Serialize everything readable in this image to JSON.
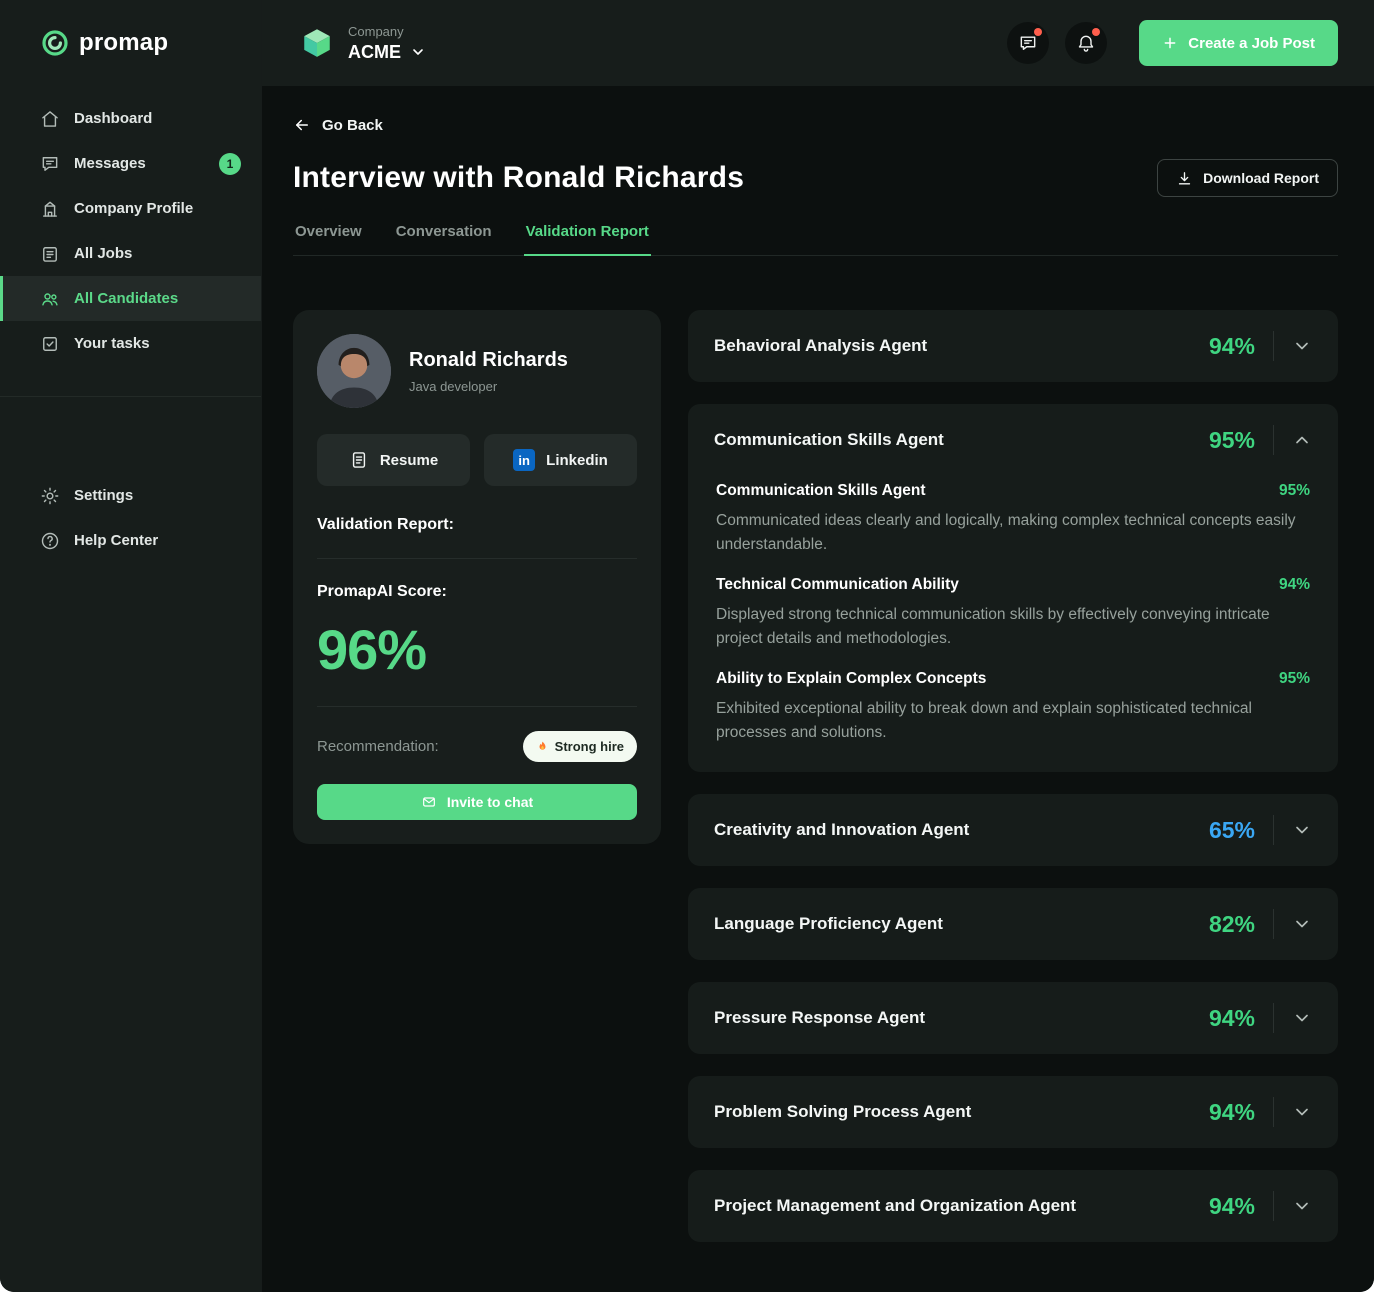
{
  "colors": {
    "accent_green": "#57d988",
    "score_green": "#3fd581",
    "score_blue": "#3aa7f4",
    "alert_red": "#ff5f4d",
    "linkedin_blue": "#0a66c2"
  },
  "sidebar": {
    "logo_text": "promap",
    "items": [
      {
        "label": "Dashboard",
        "icon": "home-icon"
      },
      {
        "label": "Messages",
        "icon": "chat-icon",
        "badge": "1"
      },
      {
        "label": "Company Profile",
        "icon": "building-icon"
      },
      {
        "label": "All Jobs",
        "icon": "clipboard-icon"
      },
      {
        "label": "All Candidates",
        "icon": "people-icon",
        "active": true
      },
      {
        "label": "Your tasks",
        "icon": "task-icon"
      }
    ],
    "footer_items": [
      {
        "label": "Settings",
        "icon": "gear-icon"
      },
      {
        "label": "Help Center",
        "icon": "help-icon"
      }
    ]
  },
  "header": {
    "company_label": "Company",
    "company_name": "ACME",
    "create_job_button": "Create a Job Post"
  },
  "page": {
    "back_label": "Go Back",
    "title": "Interview with Ronald Richards",
    "download_button": "Download Report",
    "tabs": [
      {
        "label": "Overview"
      },
      {
        "label": "Conversation"
      },
      {
        "label": "Validation Report",
        "active": true
      }
    ]
  },
  "candidate": {
    "name": "Ronald Richards",
    "role": "Java developer",
    "resume_button": "Resume",
    "linkedin_button": "Linkedin",
    "linkedin_glyph": "in",
    "validation_report_label": "Validation Report:",
    "score_label": "PromapAI Score:",
    "score": "96%",
    "recommendation_label": "Recommendation:",
    "recommendation_badge": "Strong hire",
    "invite_button": "Invite to chat"
  },
  "agents": [
    {
      "name": "Behavioral Analysis Agent",
      "score": "94%"
    },
    {
      "name": "Communication Skills Agent",
      "score": "95%",
      "expanded": true,
      "sections": [
        {
          "title": "Communication Skills Agent",
          "score": "95%",
          "text": "Communicated ideas clearly and logically, making complex technical concepts easily understandable."
        },
        {
          "title": "Technical Communication Ability",
          "score": "94%",
          "text": "Displayed strong technical communication skills by effectively conveying intricate project details and methodologies."
        },
        {
          "title": "Ability to Explain Complex Concepts",
          "score": "95%",
          "text": "Exhibited exceptional ability to break down and explain sophisticated technical processes and solutions."
        }
      ]
    },
    {
      "name": "Creativity and Innovation Agent",
      "score": "65%"
    },
    {
      "name": "Language Proficiency Agent",
      "score": "82%"
    },
    {
      "name": "Pressure Response Agent",
      "score": "94%"
    },
    {
      "name": "Problem Solving Process Agent",
      "score": "94%"
    },
    {
      "name": "Project Management and Organization Agent",
      "score": "94%"
    }
  ]
}
